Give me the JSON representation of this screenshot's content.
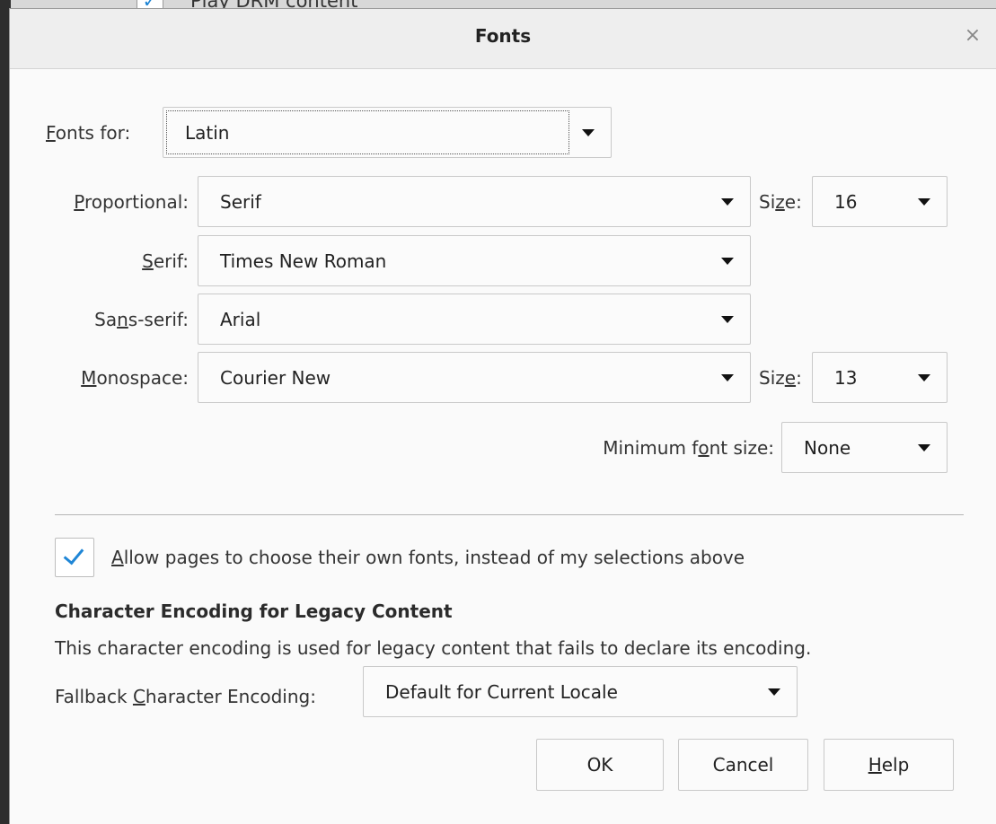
{
  "background": {
    "partial_text": "Play DRM content"
  },
  "dialog": {
    "title": "Fonts",
    "close_glyph": "×"
  },
  "fonts_for": {
    "label_accel": "F",
    "label_rest": "onts for:",
    "value": "Latin"
  },
  "proportional": {
    "label_accel": "P",
    "label_rest": "roportional:",
    "value": "Serif"
  },
  "proportional_size": {
    "label_pre": "Si",
    "label_accel": "z",
    "label_post": "e:",
    "value": "16"
  },
  "serif": {
    "label_accel": "S",
    "label_rest": "erif:",
    "value": "Times New Roman"
  },
  "sans_serif": {
    "label_pre": "Sa",
    "label_accel": "n",
    "label_post": "s-serif:",
    "value": "Arial"
  },
  "monospace": {
    "label_accel": "M",
    "label_rest": "onospace:",
    "value": "Courier New"
  },
  "monospace_size": {
    "label_pre": "Siz",
    "label_accel": "e",
    "label_post": ":",
    "value": "13"
  },
  "minimum_font_size": {
    "label_pre": "Minimum f",
    "label_accel": "o",
    "label_post": "nt size:",
    "value": "None"
  },
  "allow_pages": {
    "checked": true,
    "label_accel": "A",
    "label_rest": "llow pages to choose their own fonts, instead of my selections above"
  },
  "encoding": {
    "heading": "Character Encoding for Legacy Content",
    "description": "This character encoding is used for legacy content that fails to declare its encoding.",
    "label_pre": "Fallback ",
    "label_accel": "C",
    "label_post": "haracter Encoding:",
    "value": "Default for Current Locale"
  },
  "buttons": {
    "ok": "OK",
    "cancel": "Cancel",
    "help_accel": "H",
    "help_rest": "elp"
  },
  "colors": {
    "check_accent": "#1f86d6",
    "dialog_bg": "#fafafa",
    "titlebar_bg": "#eeeeee"
  }
}
